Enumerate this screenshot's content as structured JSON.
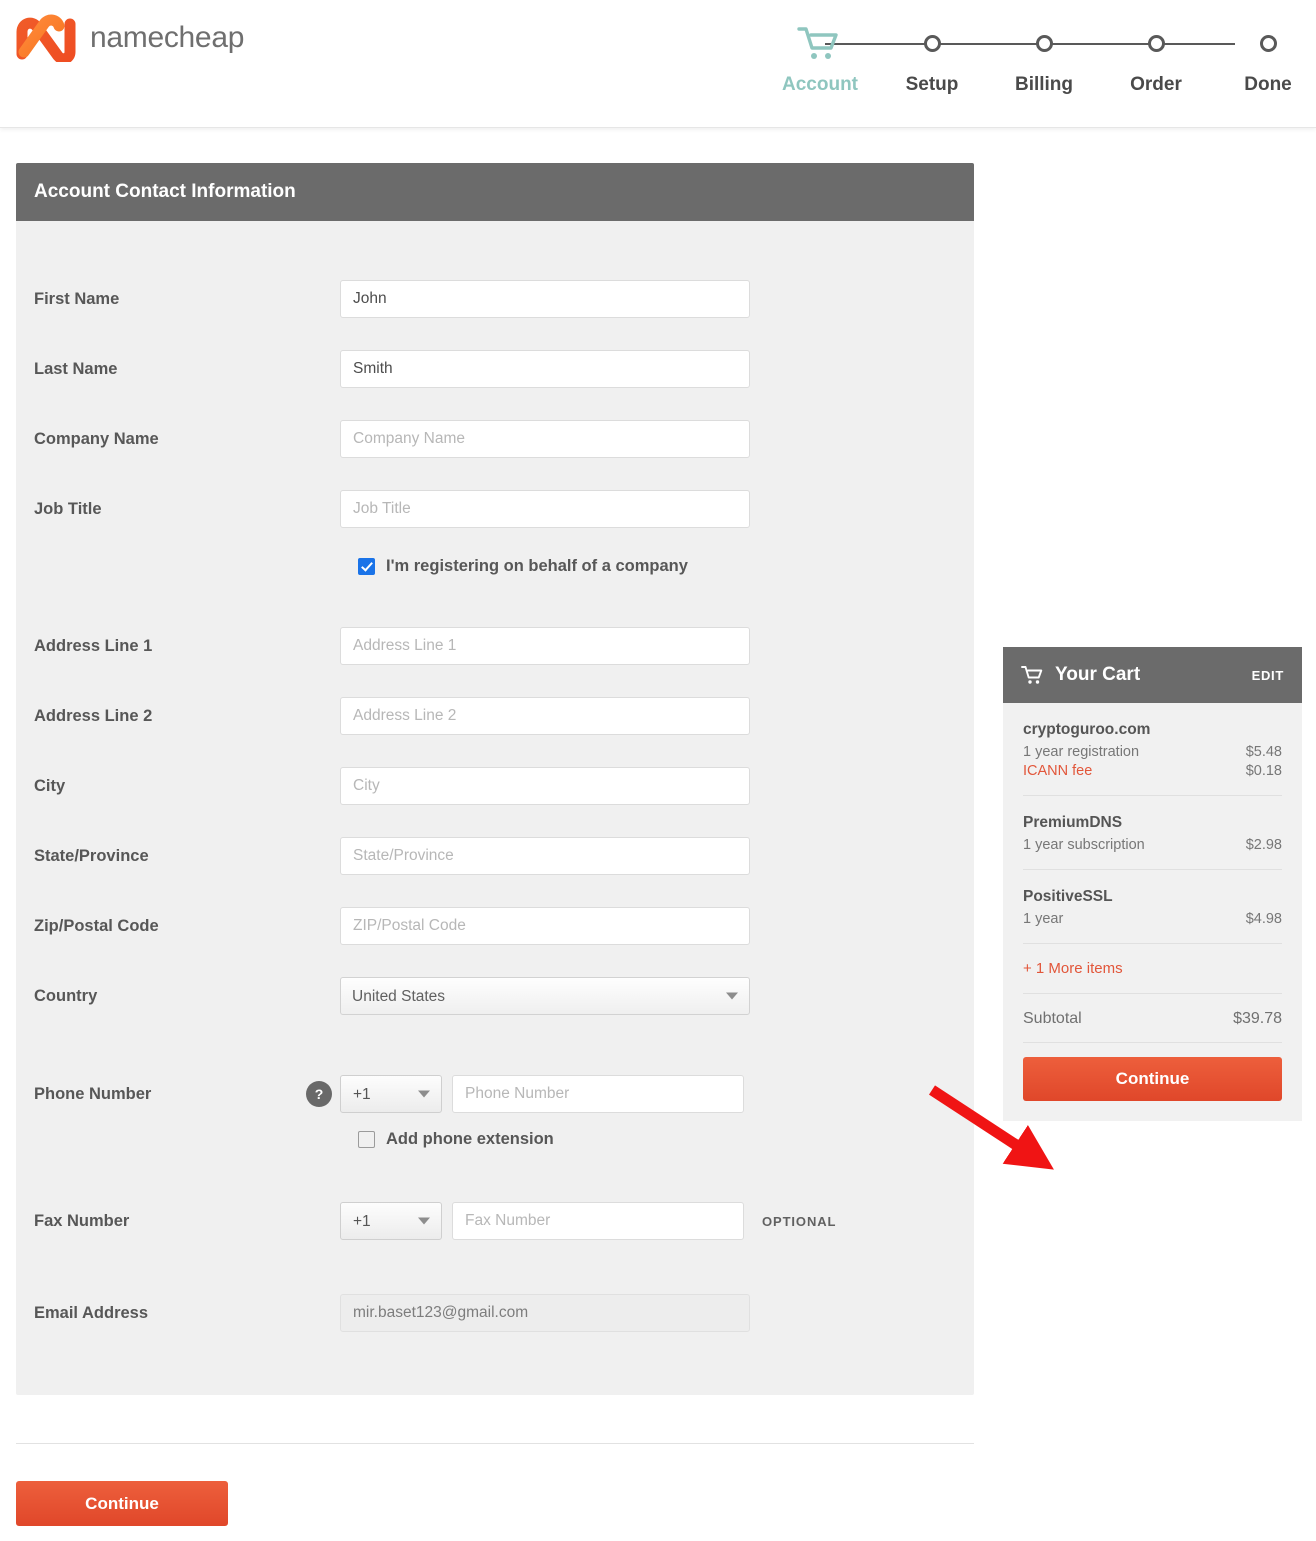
{
  "brand": {
    "name": "namecheap",
    "logo_color": "#f15a22"
  },
  "stepper": {
    "steps": [
      {
        "label": "Account",
        "icon": "cart-icon",
        "active": true
      },
      {
        "label": "Setup",
        "icon": "circle-node",
        "active": false
      },
      {
        "label": "Billing",
        "icon": "circle-node",
        "active": false
      },
      {
        "label": "Order",
        "icon": "circle-node",
        "active": false
      },
      {
        "label": "Done",
        "icon": "circle-node",
        "active": false
      }
    ],
    "active_color": "#8fc6bf",
    "inactive_color": "#4a4a4a"
  },
  "form": {
    "title": "Account Contact Information",
    "fields": {
      "first_name": {
        "label": "First Name",
        "value": "John",
        "placeholder": "First Name"
      },
      "last_name": {
        "label": "Last Name",
        "value": "Smith",
        "placeholder": "Last Name"
      },
      "company_name": {
        "label": "Company Name",
        "value": "",
        "placeholder": "Company Name"
      },
      "job_title": {
        "label": "Job Title",
        "value": "",
        "placeholder": "Job Title"
      },
      "address1": {
        "label": "Address Line 1",
        "value": "",
        "placeholder": "Address Line 1"
      },
      "address2": {
        "label": "Address Line 2",
        "value": "",
        "placeholder": "Address Line 2"
      },
      "city": {
        "label": "City",
        "value": "",
        "placeholder": "City"
      },
      "state": {
        "label": "State/Province",
        "value": "",
        "placeholder": "State/Province"
      },
      "zip": {
        "label": "Zip/Postal Code",
        "value": "",
        "placeholder": "ZIP/Postal Code"
      },
      "country": {
        "label": "Country",
        "value": "United States"
      },
      "phone": {
        "label": "Phone Number",
        "code": "+1",
        "value": "",
        "placeholder": "Phone Number",
        "help": "?"
      },
      "fax": {
        "label": "Fax Number",
        "code": "+1",
        "value": "",
        "placeholder": "Fax Number",
        "tag": "OPTIONAL"
      },
      "email": {
        "label": "Email Address",
        "value": "mir.baset123@gmail.com"
      }
    },
    "checkboxes": {
      "company_behalf": {
        "label": "I'm registering on behalf of a company",
        "checked": true
      },
      "phone_extension": {
        "label": "Add phone extension",
        "checked": false
      }
    },
    "continue_label": "Continue"
  },
  "cart": {
    "title": "Your Cart",
    "edit_label": "EDIT",
    "icon": "cart-icon",
    "items": [
      {
        "name": "cryptoguroo.com",
        "lines": [
          {
            "desc": "1 year registration",
            "amount": "$5.48",
            "fee": false
          },
          {
            "desc": "ICANN fee",
            "amount": "$0.18",
            "fee": true
          }
        ]
      },
      {
        "name": "PremiumDNS",
        "lines": [
          {
            "desc": "1 year subscription",
            "amount": "$2.98",
            "fee": false
          }
        ]
      },
      {
        "name": "PositiveSSL",
        "lines": [
          {
            "desc": "1 year",
            "amount": "$4.98",
            "fee": false
          }
        ]
      }
    ],
    "more_items_label": "+ 1 More items",
    "subtotal_label": "Subtotal",
    "subtotal_amount": "$39.78",
    "continue_label": "Continue",
    "accent_color": "#e2563a"
  },
  "annotation": {
    "type": "arrow",
    "color": "#f01414",
    "points_to": "cart-continue-button"
  }
}
